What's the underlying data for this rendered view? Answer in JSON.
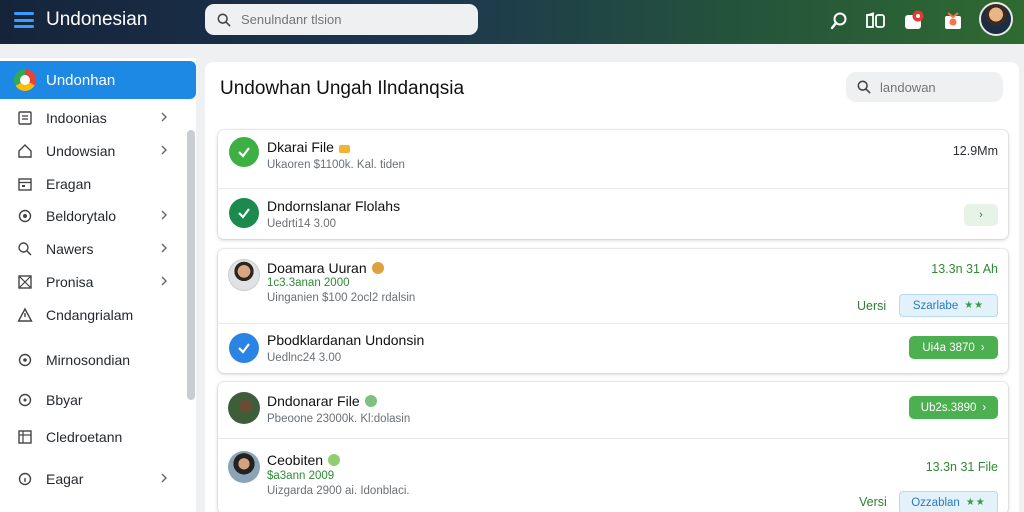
{
  "app": {
    "title": "Undonesian"
  },
  "search": {
    "placeholder": "Senulndanr tlsion"
  },
  "sidebar": {
    "active": {
      "label": "Undonhan"
    },
    "items": [
      {
        "label": "Indoonias",
        "icon": "document-icon",
        "has_chevron": true
      },
      {
        "label": "Undowsian",
        "icon": "home-icon",
        "has_chevron": true
      },
      {
        "label": "Eragan",
        "icon": "calendar-icon",
        "has_chevron": false
      },
      {
        "label": "Beldorytalo",
        "icon": "settings-icon",
        "has_chevron": true
      },
      {
        "label": "Nawers",
        "icon": "search-icon",
        "has_chevron": true
      },
      {
        "label": "Pronisa",
        "icon": "grid-icon",
        "has_chevron": true
      },
      {
        "label": "Cndangrialam",
        "icon": "warning-icon",
        "has_chevron": false
      },
      {
        "label": "Mirnosondian",
        "icon": "target-icon",
        "has_chevron": false
      },
      {
        "label": "Bbyar",
        "icon": "help-icon",
        "has_chevron": false
      },
      {
        "label": "Cledroetann",
        "icon": "table-icon",
        "has_chevron": false
      },
      {
        "label": "Eagar",
        "icon": "info-icon",
        "has_chevron": true
      }
    ]
  },
  "main": {
    "title": "Undowhan Ungah Ilndanqsia",
    "search_placeholder": "landowan",
    "cards": [
      {
        "rows": [
          {
            "title": "Dkarai File",
            "subtitle": "Ukaoren $1100k. Kal. tiden",
            "right": "12.9Mm",
            "status": "check-green"
          },
          {
            "title": "Dndornslanar Flolahs",
            "subtitle": "Uedrti14 3.00",
            "button": "›",
            "status": "check-teal"
          }
        ]
      },
      {
        "rows": [
          {
            "title": "Doamara Uuran",
            "green_line": "1c3.3anan 2000",
            "subtitle": "Uinganien $100 2ocl2 rdalsin",
            "right": "13.3n 31 Ah",
            "version_label": "Uersi",
            "badge": "Szarlabe",
            "status": "photo"
          },
          {
            "title": "Pbodklardanan Undonsin",
            "subtitle": "Uedlnc24 3.00",
            "button": "Ui4a 3870",
            "status": "check-blue"
          }
        ]
      },
      {
        "rows": [
          {
            "title": "Dndonarar File",
            "subtitle": "Pbeoone 23000k. Kl:dolasin",
            "button": "Ub2s.3890",
            "status": "photo"
          },
          {
            "title": "Ceobiten",
            "green_line": "$a3ann 2009",
            "subtitle": "Uizgarda 2900 ai. Idonblaci.",
            "right": "13.3n 31 File",
            "version_label": "Versi",
            "badge": "Ozzablan",
            "status": "photo"
          }
        ]
      }
    ]
  },
  "colors": {
    "accent": "#1e88e5",
    "success": "#4caf50",
    "teal": "#1b8a4c"
  }
}
